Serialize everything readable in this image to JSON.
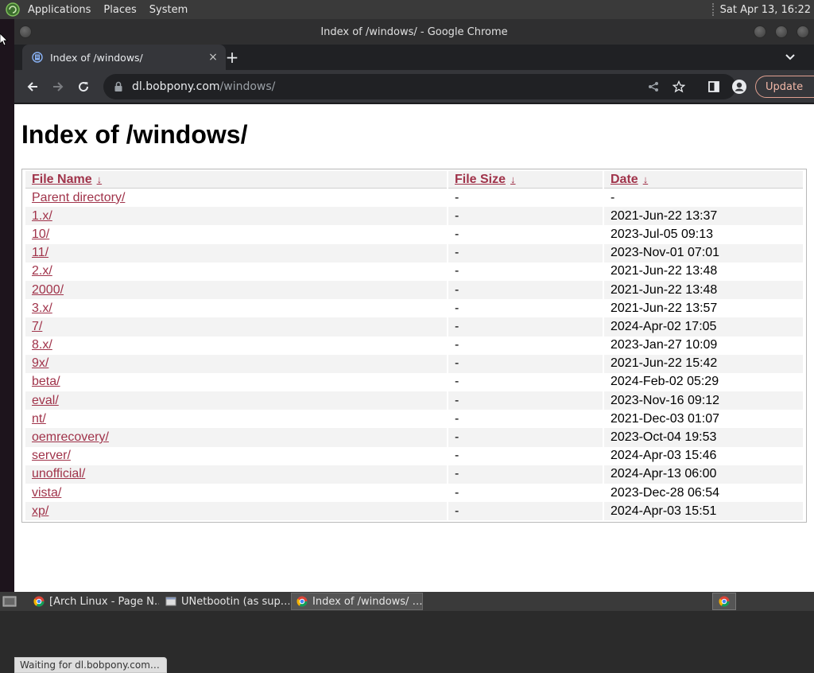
{
  "top_panel": {
    "menus": [
      "Applications",
      "Places",
      "System"
    ],
    "clock": "Sat Apr 13, 16:22"
  },
  "window": {
    "title": "Index of /windows/ - Google Chrome"
  },
  "tab": {
    "title": "Index of /windows/",
    "close_glyph": "×",
    "new_tab_glyph": "+"
  },
  "omnibox": {
    "host": "dl.bobpony.com",
    "path": "/windows/"
  },
  "toolbar": {
    "update_label": "Update"
  },
  "page": {
    "heading": "Index of /windows/",
    "columns": [
      {
        "label": "File Name",
        "sort": "↓"
      },
      {
        "label": "File Size",
        "sort": "↓"
      },
      {
        "label": "Date",
        "sort": "↓"
      }
    ],
    "rows": [
      {
        "name": "Parent directory/",
        "size": "-",
        "date": "-"
      },
      {
        "name": "1.x/",
        "size": "-",
        "date": "2021-Jun-22 13:37"
      },
      {
        "name": "10/",
        "size": "-",
        "date": "2023-Jul-05 09:13"
      },
      {
        "name": "11/",
        "size": "-",
        "date": "2023-Nov-01 07:01"
      },
      {
        "name": "2.x/",
        "size": "-",
        "date": "2021-Jun-22 13:48"
      },
      {
        "name": "2000/",
        "size": "-",
        "date": "2021-Jun-22 13:48"
      },
      {
        "name": "3.x/",
        "size": "-",
        "date": "2021-Jun-22 13:57"
      },
      {
        "name": "7/",
        "size": "-",
        "date": "2024-Apr-02 17:05"
      },
      {
        "name": "8.x/",
        "size": "-",
        "date": "2023-Jan-27 10:09"
      },
      {
        "name": "9x/",
        "size": "-",
        "date": "2021-Jun-22 15:42"
      },
      {
        "name": "beta/",
        "size": "-",
        "date": "2024-Feb-02 05:29"
      },
      {
        "name": "eval/",
        "size": "-",
        "date": "2023-Nov-16 09:12"
      },
      {
        "name": "nt/",
        "size": "-",
        "date": "2021-Dec-03 01:07"
      },
      {
        "name": "oemrecovery/",
        "size": "-",
        "date": "2023-Oct-04 19:53"
      },
      {
        "name": "server/",
        "size": "-",
        "date": "2024-Apr-03 15:46"
      },
      {
        "name": "unofficial/",
        "size": "-",
        "date": "2024-Apr-13 06:00"
      },
      {
        "name": "vista/",
        "size": "-",
        "date": "2023-Dec-28 06:54"
      },
      {
        "name": "xp/",
        "size": "-",
        "date": "2024-Apr-03 15:51"
      }
    ]
  },
  "status_bar": "Waiting for dl.bobpony.com…",
  "taskbar": {
    "tasks": [
      {
        "label": "[Arch Linux - Page N…",
        "icon": "chrome-icon"
      },
      {
        "label": "UNetbootin (as sup…",
        "icon": "window-icon"
      },
      {
        "label": "Index of /windows/ …",
        "icon": "chrome-icon"
      }
    ]
  },
  "colors": {
    "link": "#a0334a",
    "update_accent": "#f2b8a8"
  }
}
